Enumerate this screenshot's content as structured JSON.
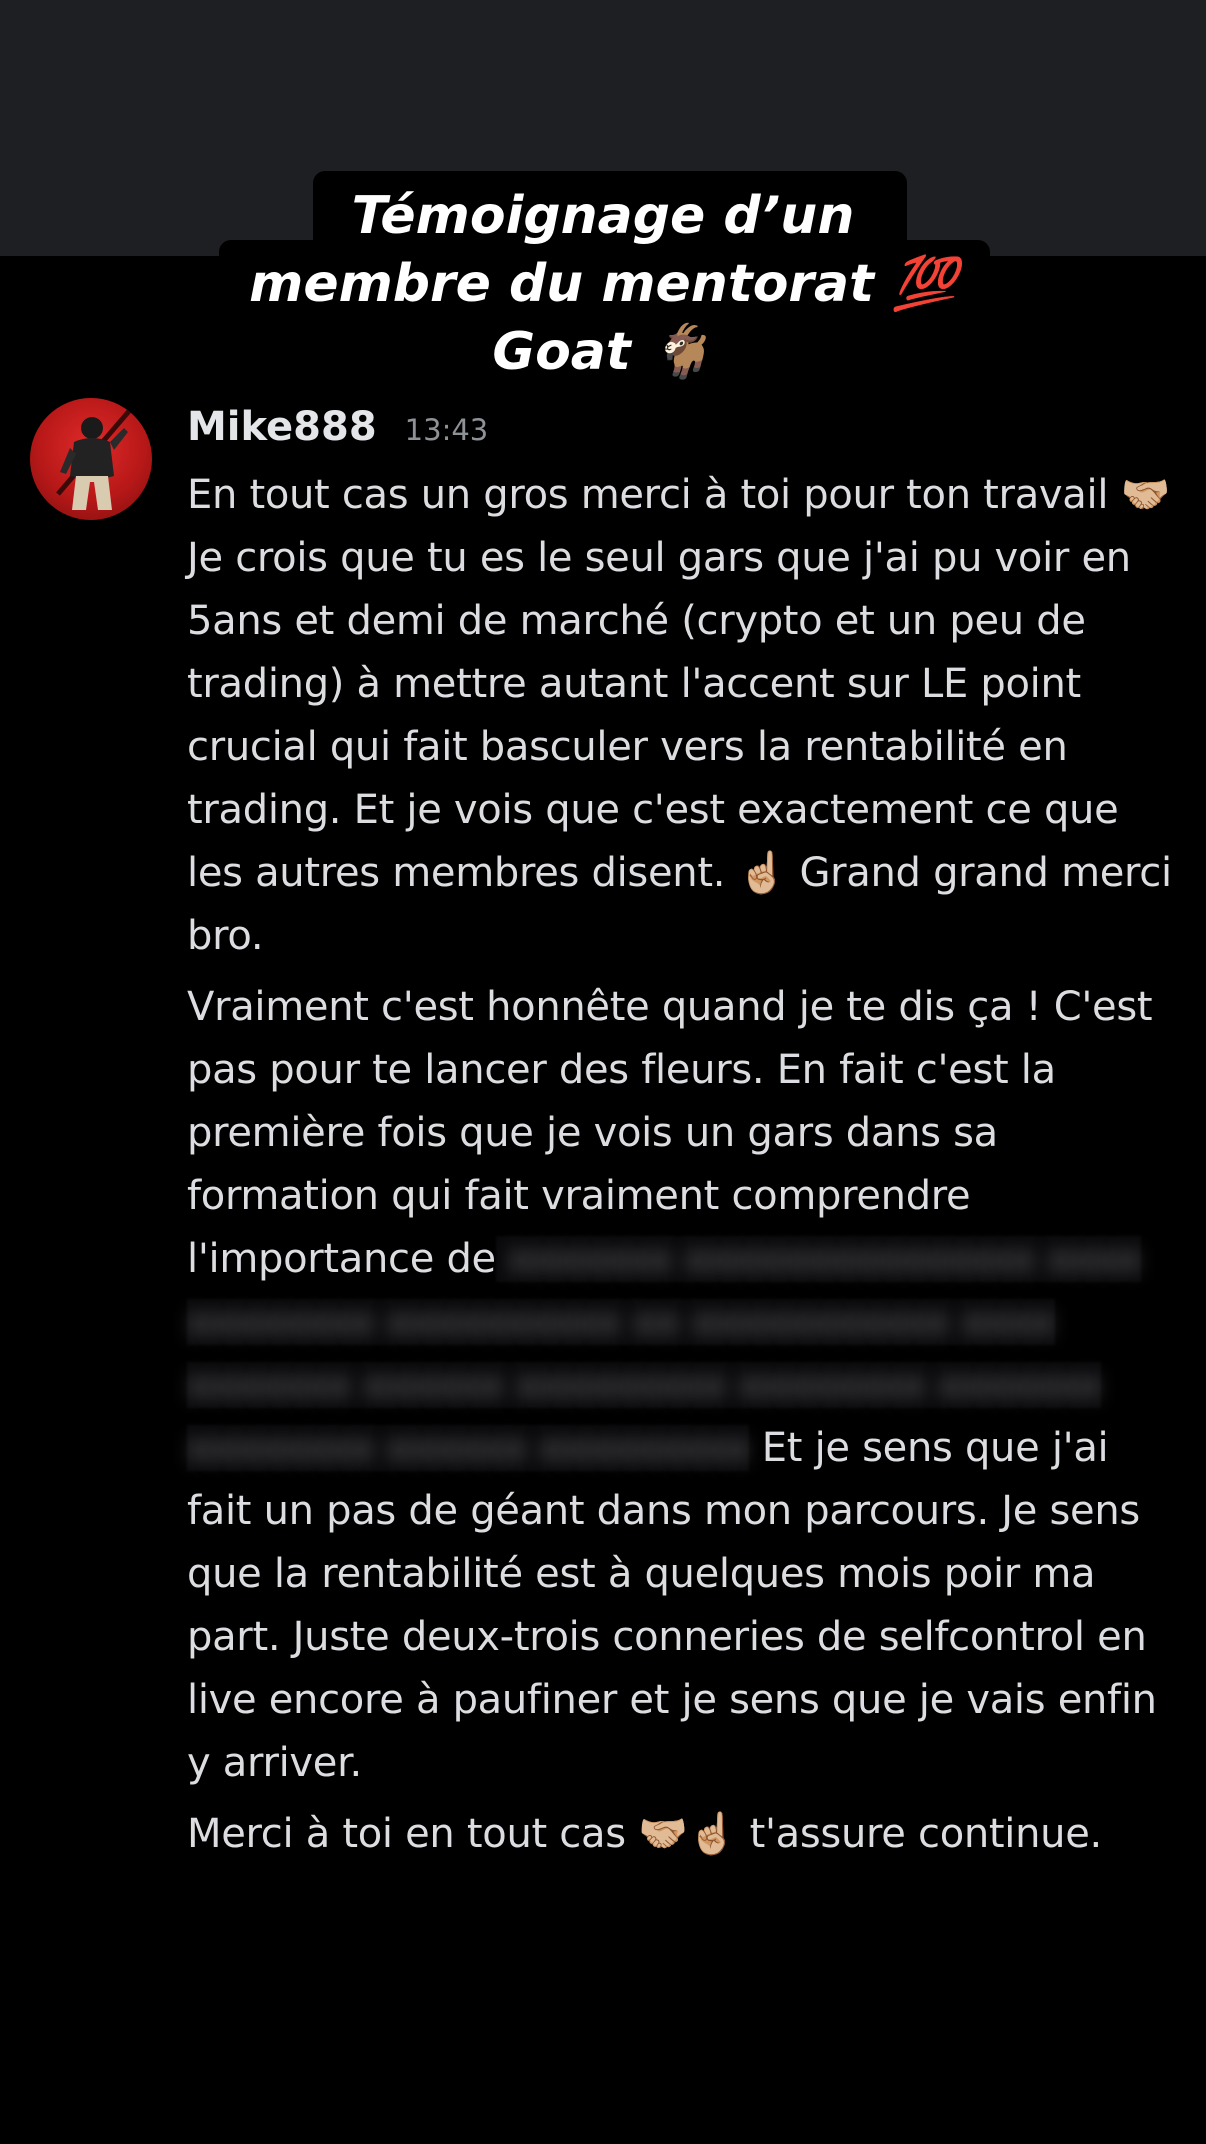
{
  "title": {
    "line1": "Témoignage d’un",
    "line2": "membre du mentorat 💯",
    "line3": "Goat 🐐"
  },
  "message": {
    "username": "Mike888",
    "timestamp": "13:43",
    "avatar_icon": "avatar-character-icon",
    "paragraph1": "En tout cas un gros merci à toi pour ton travail 🤝🏼 Je crois que tu es le seul gars que j'ai pu voir en 5ans et demi de marché (crypto et un peu de trading) à mettre autant l'accent sur LE point crucial qui fait basculer vers la rentabilité en trading. Et je vois que c'est exactement ce que les autres membres disent. ☝🏼 Grand grand merci bro.",
    "paragraph2_start": "Vraiment c'est honnête quand je te dis ça ! C'est pas pour te lancer des fleurs. En fait c'est la première fois que je vois un gars dans sa formation qui fait vraiment comprendre l'importance de",
    "paragraph2_end": " Et je sens que j'ai fait un pas de géant dans mon parcours. Je sens que la rentabilité est à quelques mois poir ma part. Juste deux-trois conneries de selfcontrol en live encore à paufiner et je sens que je vais enfin y arriver.",
    "paragraph3": "Merci à toi en tout cas 🤝🏼☝🏼 t'assure continue."
  }
}
